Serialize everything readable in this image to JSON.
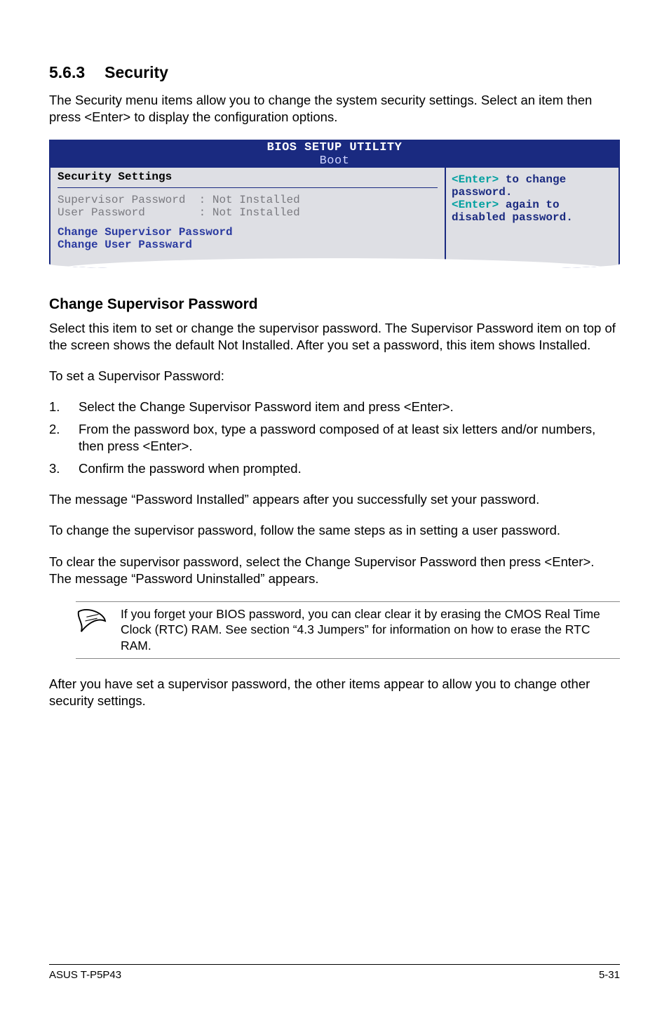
{
  "heading": {
    "num": "5.6.3",
    "title": "Security"
  },
  "intro": "The Security menu items allow you to change the system security settings. Select an item then press <Enter> to display the configuration options.",
  "bios": {
    "topline": "BIOS SETUP UTILITY",
    "tab": "Boot",
    "section": "Security Settings",
    "row1_label": "Supervisor Password",
    "row1_val": ": Not Installed",
    "row2_label": "User Password",
    "row2_val": ": Not Installed",
    "opt1": "Change Supervisor Password",
    "opt2": "Change User Passward",
    "help1a": "<Enter>",
    "help1b": " to change",
    "help2": "password.",
    "help3a": "<Enter>",
    "help3b": " again to",
    "help4": "disabled password."
  },
  "subheading": "Change Supervisor Password",
  "p1": "Select this item to set or change the supervisor password. The Supervisor Password item on top of the screen shows the default Not Installed. After you set a password, this item shows Installed.",
  "p2": "To set a Supervisor Password:",
  "list": {
    "n1": "1.",
    "t1": "Select the Change Supervisor Password item and press <Enter>.",
    "n2": "2.",
    "t2": "From the password box, type a password composed of at least six letters and/or numbers, then press <Enter>.",
    "n3": "3.",
    "t3": "Confirm the password when prompted."
  },
  "p3": "The message “Password Installed” appears after you successfully set your password.",
  "p4": "To change the supervisor password, follow the same steps as in setting a user password.",
  "p5": "To clear the supervisor password, select the Change Supervisor Password then press <Enter>. The message “Password Uninstalled” appears.",
  "note": "If you forget your BIOS password, you can clear clear it by erasing the CMOS Real Time Clock (RTC) RAM. See section “4.3  Jumpers” for information on how to erase the RTC RAM.",
  "p6": "After you have set a supervisor password, the other items appear to allow you to change other security settings.",
  "footer_left": "ASUS T-P5P43",
  "footer_right": "5-31"
}
